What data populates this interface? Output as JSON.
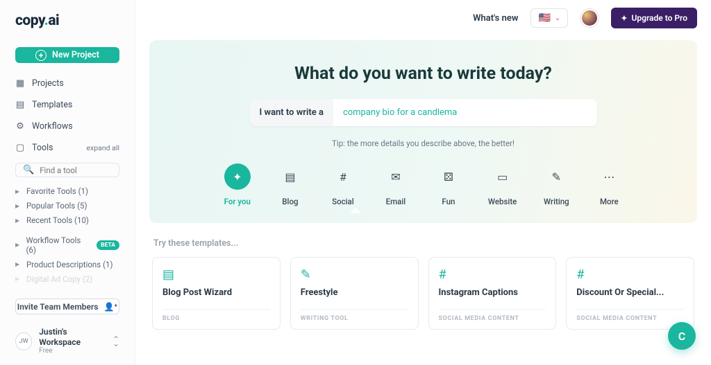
{
  "brand": {
    "pre": "copy",
    "dot": ".",
    "post": "ai"
  },
  "sidebar": {
    "new_label": "New Project",
    "nav": [
      "Projects",
      "Templates",
      "Workflows",
      "Tools"
    ],
    "expand": "expand all",
    "search_placeholder": "Find a tool",
    "tree1": [
      "Favorite Tools (1)",
      "Popular Tools (5)",
      "Recent Tools (10)"
    ],
    "tree2": [
      {
        "label": "Workflow Tools (6)",
        "badge": "BETA"
      },
      {
        "label": "Product Descriptions (1)"
      },
      {
        "label": "Digital Ad Copy (2)"
      }
    ],
    "invite": "Invite Team Members"
  },
  "workspace": {
    "initials": "JW",
    "name": "Justin's Workspace",
    "plan": "Free"
  },
  "header": {
    "whats_new": "What's new",
    "flag": "🇺🇸",
    "upgrade": "Upgrade to Pro"
  },
  "hero": {
    "title": "What do you want to write today?",
    "prefix": "I want to write a",
    "value": "company bio for a candlema",
    "tip": "Tip: the more details you describe above, the better!"
  },
  "categories": [
    {
      "icon": "sparkle",
      "label": "For you",
      "active": true
    },
    {
      "icon": "blog",
      "label": "Blog"
    },
    {
      "icon": "hash",
      "label": "Social"
    },
    {
      "icon": "mail",
      "label": "Email"
    },
    {
      "icon": "dice",
      "label": "Fun"
    },
    {
      "icon": "folder",
      "label": "Website"
    },
    {
      "icon": "file",
      "label": "Writing"
    },
    {
      "icon": "dots",
      "label": "More"
    }
  ],
  "templates": {
    "heading": "Try these templates...",
    "items": [
      {
        "icon": "blog",
        "name": "Blog Post Wizard",
        "cat": "Blog"
      },
      {
        "icon": "file",
        "name": "Freestyle",
        "cat": "Writing Tool"
      },
      {
        "icon": "hash",
        "name": "Instagram Captions",
        "cat": "Social Media Content"
      },
      {
        "icon": "hash",
        "name": "Discount Or Special...",
        "cat": "Social Media Content"
      }
    ]
  },
  "fab": "C"
}
